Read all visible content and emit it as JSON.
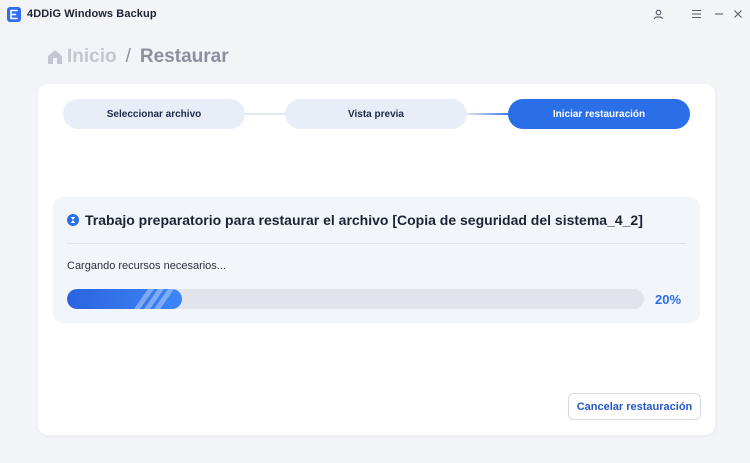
{
  "app": {
    "title": "4DDiG Windows Backup",
    "logo_letter": "E",
    "accent": "#2b6fe8"
  },
  "window_controls": [
    "user-icon",
    "menu-icon",
    "minimize-icon",
    "close-icon"
  ],
  "breadcrumb": {
    "home_label": "Inicio",
    "separator": "/",
    "current": "Restaurar"
  },
  "steps": [
    {
      "label": "Seleccionar archivo",
      "active": false
    },
    {
      "label": "Vista previa",
      "active": false
    },
    {
      "label": "Iniciar restauración",
      "active": true
    }
  ],
  "task": {
    "title": "Trabajo preparatorio para restaurar el archivo [Copia de seguridad del sistema_4_2]",
    "status": "Cargando recursos necesarios...",
    "progress": 0.2,
    "progress_label": "20%"
  },
  "actions": {
    "cancel_label": "Cancelar restauración"
  }
}
